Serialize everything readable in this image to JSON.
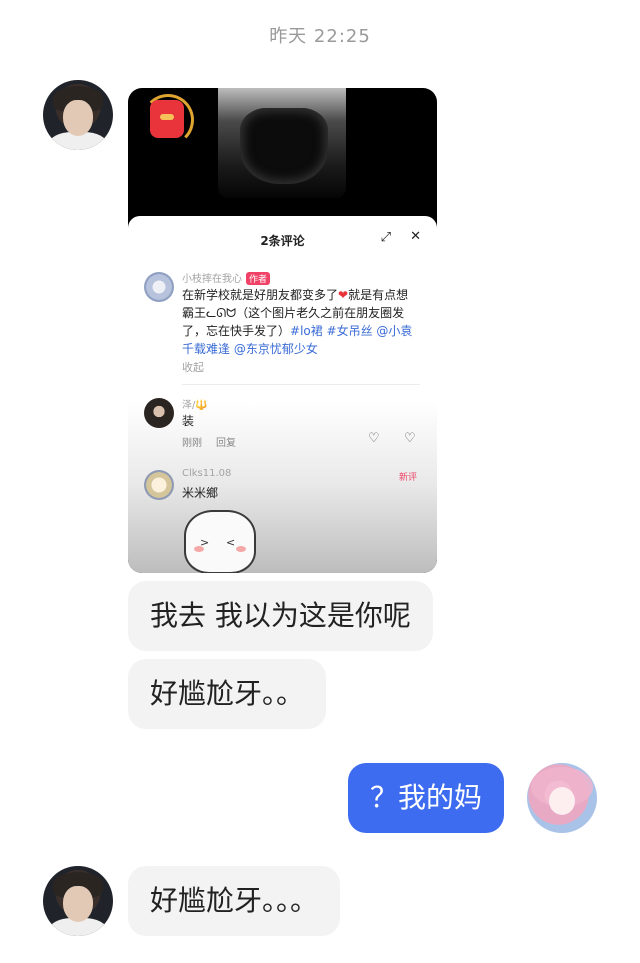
{
  "timestamp": "昨天 22:25",
  "shared_post": {
    "comments_title": "2条评论",
    "comments": [
      {
        "name": "小枝摔在我心",
        "badge": "作者",
        "text_main": "在新学校就是好朋友都变多了",
        "heart_emoji": "❤",
        "text_rest": "就是有点想霸王ᓚᘏᗢ（这个图片老久之前在朋友圈发了，忘在快手发了）",
        "tags": "#lo裙 #女吊丝 @小袁千载难逢 @东京忧郁少女",
        "expand": "收起"
      },
      {
        "name": "泽/🔱",
        "text": "装",
        "time": "刚刚",
        "reply": "回复"
      },
      {
        "name": "Clks11.08",
        "text": "米米鄉",
        "new_label": "新评"
      }
    ],
    "icons": {
      "expand": "expand-icon",
      "close": "close-icon",
      "like": "heart-icon",
      "dislike": "dislike-icon"
    }
  },
  "messages": [
    {
      "text": "我去 我以为这是你呢",
      "from": "them"
    },
    {
      "text": "好尴尬牙。。",
      "from": "them"
    },
    {
      "text": "？我的妈",
      "from": "me"
    },
    {
      "text": "好尴尬牙。。。",
      "from": "them"
    }
  ],
  "colors": {
    "my_bubble": "#3d6cf0",
    "their_bubble": "#f3f3f3",
    "badge": "#f04166",
    "tag_link": "#3a6bd6"
  }
}
